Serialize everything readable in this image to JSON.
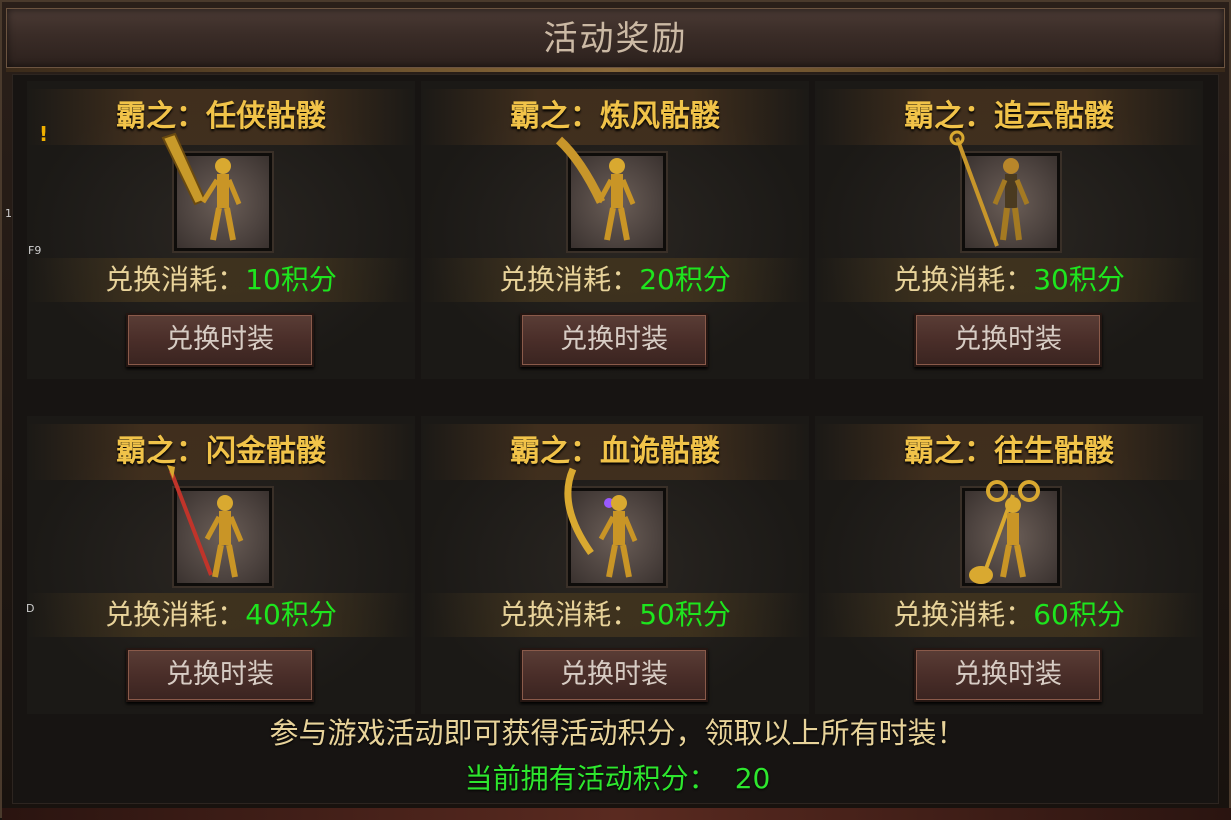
{
  "window": {
    "title": "活动奖励"
  },
  "cards": [
    {
      "name": "霸之：任侠骷髅",
      "cost_label": "兑换消耗：",
      "cost_value": "10积分",
      "button": "兑换时装",
      "weapon": "broad-blade"
    },
    {
      "name": "霸之：炼风骷髅",
      "cost_label": "兑换消耗：",
      "cost_value": "20积分",
      "button": "兑换时装",
      "weapon": "curved-saber"
    },
    {
      "name": "霸之：追云骷髅",
      "cost_label": "兑换消耗：",
      "cost_value": "30积分",
      "button": "兑换时装",
      "weapon": "staff"
    },
    {
      "name": "霸之：闪金骷髅",
      "cost_label": "兑换消耗：",
      "cost_value": "40积分",
      "button": "兑换时装",
      "weapon": "spear"
    },
    {
      "name": "霸之：血诡骷髅",
      "cost_label": "兑换消耗：",
      "cost_value": "50积分",
      "button": "兑换时装",
      "weapon": "scythe"
    },
    {
      "name": "霸之：往生骷髅",
      "cost_label": "兑换消耗：",
      "cost_value": "60积分",
      "button": "兑换时装",
      "weapon": "double-axe"
    }
  ],
  "footer": {
    "note": "参与游戏活动即可获得活动积分，领取以上所有时装！",
    "points_label": "当前拥有活动积分：",
    "points_value": "20"
  },
  "overlay": {
    "mark_1": "1",
    "mark_f9": "F9",
    "mark_d": "D",
    "alert": "!"
  },
  "colors": {
    "gold_title": "#f1c349",
    "cost_green": "#1ee51e",
    "button_bg": "#4a2e29"
  }
}
